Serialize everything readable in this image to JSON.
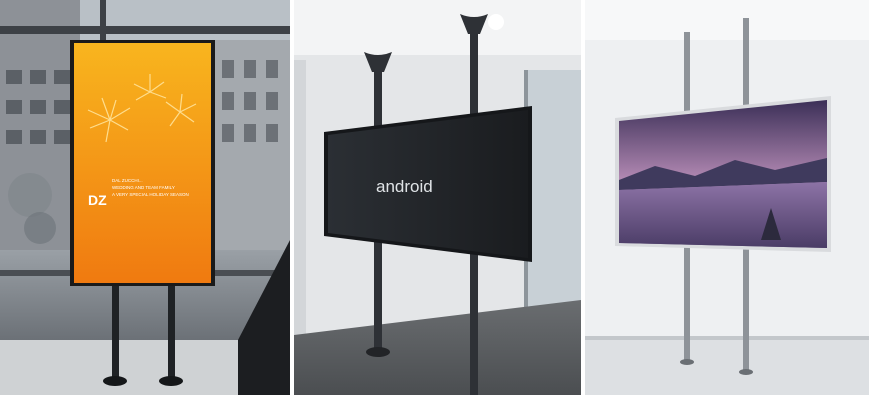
{
  "photos": [
    {
      "signage": {
        "logo_mark": "DZ",
        "lines": [
          "DAL ZUCCHI...",
          "WEDDING AND TEAM FAMILY",
          "A VERY SPECIAL HOLIDAY SEASON"
        ]
      }
    },
    {
      "screen_logo": "android"
    },
    {}
  ],
  "colors": {
    "signage_top": "#f7b21c",
    "signage_bottom": "#f07c10",
    "mount_pole": "#2e3136",
    "sky_top": "#3b2f57",
    "sky_glow": "#c9a0c0"
  }
}
